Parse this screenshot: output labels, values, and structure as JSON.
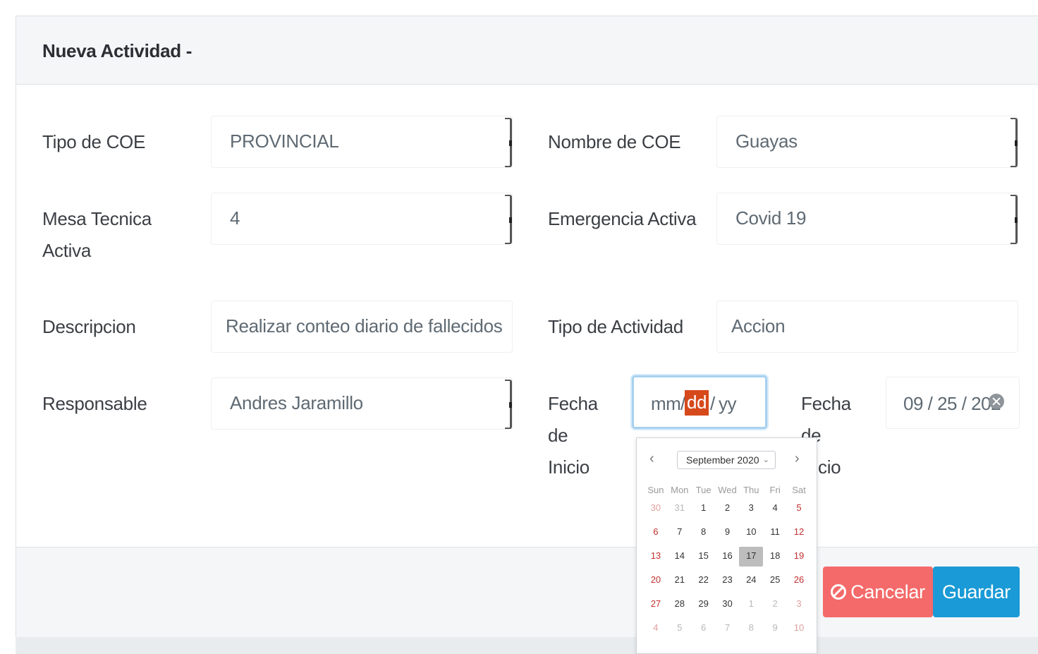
{
  "modal": {
    "title": "Nueva Actividad -"
  },
  "form": {
    "tipo_coe": {
      "label": "Tipo de COE",
      "value": "PROVINCIAL"
    },
    "nombre_coe": {
      "label": "Nombre de COE",
      "value": "Guayas"
    },
    "mesa_tecnica": {
      "label_line1": "Mesa Tecnica",
      "label_line2": "Activa",
      "value": "4"
    },
    "emergencia": {
      "label": "Emergencia Activa",
      "value": "Covid 19"
    },
    "descripcion": {
      "label": "Descripcion",
      "value": "Realizar conteo diario de fallecidos"
    },
    "tipo_actividad": {
      "label": "Tipo de Actividad",
      "value": "Accion"
    },
    "responsable": {
      "label": "Responsable",
      "value": "Andres Jaramillo"
    },
    "fecha_inicio": {
      "label_line1": "Fecha",
      "label_line2": "de",
      "label_line3": "Inicio",
      "mm": "mm",
      "sep1": "/",
      "dd": "dd",
      "sep2": "/",
      "yy": "yy"
    },
    "fecha_fin": {
      "label_line1": "Fecha",
      "label_line2": "de",
      "label_line3": "cio",
      "value": "09 / 25 / 202"
    }
  },
  "calendar": {
    "prev": "‹",
    "next": "›",
    "month_label": "September 2020",
    "weekdays": [
      "Sun",
      "Mon",
      "Tue",
      "Wed",
      "Thu",
      "Fri",
      "Sat"
    ],
    "weeks": [
      [
        "30",
        "31",
        "1",
        "2",
        "3",
        "4",
        "5"
      ],
      [
        "6",
        "7",
        "8",
        "9",
        "10",
        "11",
        "12"
      ],
      [
        "13",
        "14",
        "15",
        "16",
        "17",
        "18",
        "19"
      ],
      [
        "20",
        "21",
        "22",
        "23",
        "24",
        "25",
        "26"
      ],
      [
        "27",
        "28",
        "29",
        "30",
        "1",
        "2",
        "3"
      ],
      [
        "4",
        "5",
        "6",
        "7",
        "8",
        "9",
        "10"
      ]
    ],
    "selected_day": "17"
  },
  "footer": {
    "cancel_label": "Cancelar",
    "save_label": "Guardar"
  },
  "colors": {
    "cancel": "#f46a6a",
    "save": "#1a9ad6",
    "date_highlight": "#d6491b",
    "weekend": "#c23030"
  },
  "icons": {
    "cancel": "ban-icon",
    "clear": "clear-icon",
    "prev": "chevron-left-icon",
    "next": "chevron-right-icon",
    "month_dropdown": "chevron-down-icon"
  }
}
